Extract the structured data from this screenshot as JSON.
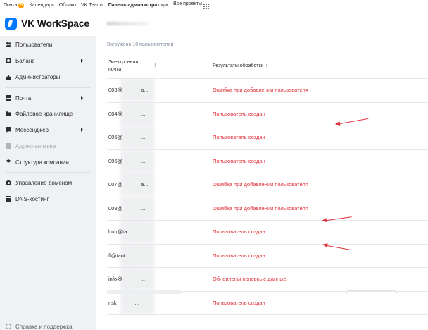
{
  "topnav": {
    "items": [
      {
        "label": "Почта",
        "badge": "5"
      },
      {
        "label": "Календарь"
      },
      {
        "label": "Облако"
      },
      {
        "label": "VK Teams"
      },
      {
        "label": "Панель администратора",
        "active": true
      },
      {
        "label": "Все проекты"
      }
    ],
    "apps_icon": "grid-icon"
  },
  "header": {
    "logo_text": "VK WorkSpace"
  },
  "sidebar": {
    "items": [
      {
        "label": "Пользователи",
        "icon": "users-icon",
        "expandable": false
      },
      {
        "label": "Баланс",
        "icon": "coins-icon",
        "expandable": true
      },
      {
        "label": "Администраторы",
        "icon": "crown-icon",
        "expandable": false
      },
      {
        "label": "Почта",
        "icon": "mail-icon",
        "expandable": true
      },
      {
        "label": "Файловое хранилище",
        "icon": "folder-icon",
        "expandable": false
      },
      {
        "label": "Мессенджер",
        "icon": "chat-icon",
        "expandable": true
      },
      {
        "label": "Адресная книга",
        "icon": "address-book-icon",
        "expandable": false,
        "disabled": true
      },
      {
        "label": "Структура компании",
        "icon": "layers-icon",
        "expandable": false
      },
      {
        "label": "Управление доменом",
        "icon": "gear-icon",
        "expandable": false
      },
      {
        "label": "DNS-хостинг",
        "icon": "dns-icon",
        "expandable": false
      }
    ],
    "help": {
      "label": "Справка и поддержка",
      "icon": "help-icon"
    }
  },
  "main": {
    "loaded_text": "Загружено 10 пользователей",
    "columns": {
      "email": "Электронная почта",
      "result": "Результаты обработки"
    },
    "rows": [
      {
        "email": "003@",
        "suffix": "a...",
        "result": "Ошибка при добавлении пользователя",
        "status": "error"
      },
      {
        "email": "004@",
        "suffix": "...",
        "result": "Пользователь создан",
        "status": "created"
      },
      {
        "email": "005@",
        "suffix": "...",
        "result": "Пользователь создан",
        "status": "created"
      },
      {
        "email": "006@",
        "suffix": "...",
        "result": "Пользователь создан",
        "status": "created"
      },
      {
        "email": "007@",
        "suffix": "a...",
        "result": "Ошибка при добавлении пользователя",
        "status": "error"
      },
      {
        "email": "008@",
        "suffix": "...",
        "result": "Ошибка при добавлении пользователя",
        "status": "error"
      },
      {
        "email": "buh@ta",
        "suffix": "...",
        "result": "Пользователь создан",
        "status": "created"
      },
      {
        "email": "fl@tant",
        "suffix": "...",
        "result": "Пользователь создан",
        "status": "created"
      },
      {
        "email": "info@",
        "suffix": "...",
        "result": "Обновлены основные данные",
        "status": "updated"
      },
      {
        "email": "nsk",
        "suffix": "...",
        "result": "Пользователь создан",
        "status": "created"
      }
    ],
    "annotated_rows": [
      0,
      4,
      5
    ]
  },
  "colors": {
    "result_text": "#e0323c",
    "accent": "#0077ff",
    "sidebar_bg": "#f0f1f3",
    "annotation_arrow": "#e0323c"
  }
}
